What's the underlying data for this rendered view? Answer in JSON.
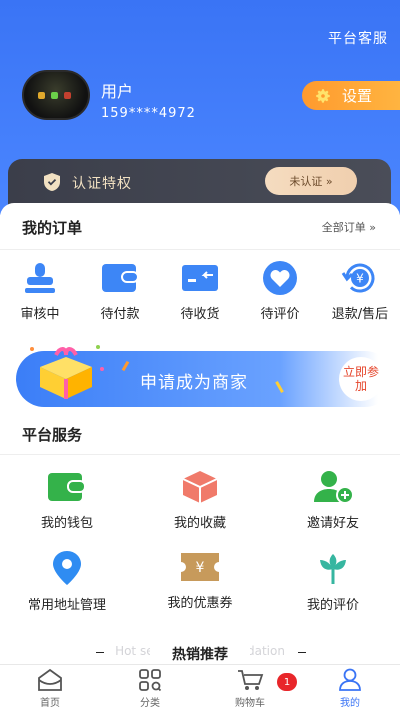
{
  "header": {
    "service_link": "平台客服",
    "username": "用户",
    "phone": "159****4972",
    "settings_label": "设置"
  },
  "certification": {
    "title": "认证特权",
    "status_button": "未认证 »"
  },
  "orders": {
    "title": "我的订单",
    "all_link": "全部订单 »",
    "items": [
      {
        "label": "审核中",
        "icon": "stamp-icon"
      },
      {
        "label": "待付款",
        "icon": "wallet-icon"
      },
      {
        "label": "待收货",
        "icon": "delivery-icon"
      },
      {
        "label": "待评价",
        "icon": "heart-icon"
      },
      {
        "label": "退款/售后",
        "icon": "refund-icon"
      }
    ]
  },
  "merchant_banner": {
    "text": "申请成为商家",
    "button": "立即参加"
  },
  "services": {
    "title": "平台服务",
    "items": [
      {
        "label": "我的钱包",
        "icon": "wallet-icon"
      },
      {
        "label": "我的收藏",
        "icon": "box-icon"
      },
      {
        "label": "邀请好友",
        "icon": "add-user-icon"
      },
      {
        "label": "常用地址管理",
        "icon": "location-pin-icon"
      },
      {
        "label": "我的优惠券",
        "icon": "coupon-icon"
      },
      {
        "label": "我的评价",
        "icon": "flower-icon"
      }
    ]
  },
  "hot": {
    "title": "热销推荐",
    "background_text": "Hot selling recommendation"
  },
  "tabbar": {
    "items": [
      {
        "label": "首页",
        "icon": "home-icon"
      },
      {
        "label": "分类",
        "icon": "category-icon"
      },
      {
        "label": "购物车",
        "icon": "cart-icon"
      },
      {
        "label": "我的",
        "icon": "profile-icon"
      }
    ],
    "cart_badge": "1",
    "active": "我的"
  },
  "colors": {
    "primary": "#3a74f5",
    "accent_orange": "#ff9a2e",
    "badge_red": "#e8262a"
  }
}
